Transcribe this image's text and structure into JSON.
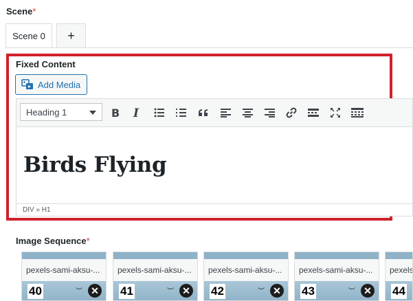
{
  "scene": {
    "label": "Scene",
    "required_mark": "*"
  },
  "tabs": [
    {
      "label": "Scene 0"
    },
    {
      "label": "+"
    }
  ],
  "fixed_content": {
    "label": "Fixed Content",
    "add_media_label": "Add Media",
    "format_select": "Heading 1",
    "toolbar_icons": [
      "bold-icon",
      "italic-icon",
      "bullet-list-icon",
      "numbered-list-icon",
      "blockquote-icon",
      "align-left-icon",
      "align-center-icon",
      "align-right-icon",
      "link-icon",
      "read-more-icon",
      "fullscreen-icon",
      "toolbar-toggle-icon"
    ],
    "heading_text": "Birds Flying",
    "status_path": "DIV » H1"
  },
  "image_sequence": {
    "label": "Image Sequence",
    "required_mark": "*",
    "items": [
      {
        "filename": "pexels-sami-aksu-...",
        "number": "40"
      },
      {
        "filename": "pexels-sami-aksu-...",
        "number": "41"
      },
      {
        "filename": "pexels-sami-aksu-...",
        "number": "42"
      },
      {
        "filename": "pexels-sami-aksu-...",
        "number": "43"
      },
      {
        "filename": "pexels-sami-aksu-...",
        "number": "44"
      }
    ],
    "remove_symbol": "✕"
  },
  "colors": {
    "highlight_border": "#d0202a",
    "accent": "#2271b1",
    "required": "#d63638"
  }
}
